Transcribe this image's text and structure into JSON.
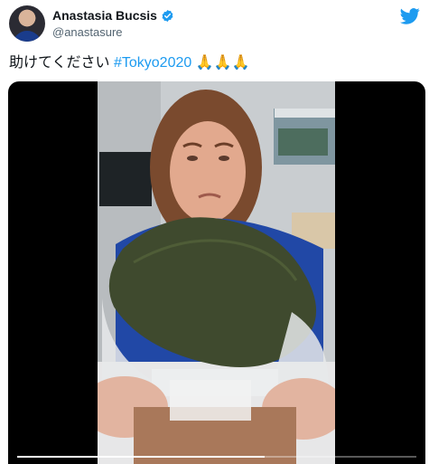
{
  "user": {
    "name": "Anastasia Bucsis",
    "handle": "@anastasure"
  },
  "tweet": {
    "text": "助けてください",
    "hashtag": "#Tokyo2020",
    "emojis": "🙏🙏🙏"
  },
  "icons": {
    "verified": "verified-badge-icon",
    "brand": "twitter-bird-icon"
  },
  "colors": {
    "accent": "#1d9bf0",
    "verified": "#1d9bf0",
    "text": "#0f1419",
    "secondary": "#536471"
  },
  "video": {
    "progress": 0.62
  }
}
